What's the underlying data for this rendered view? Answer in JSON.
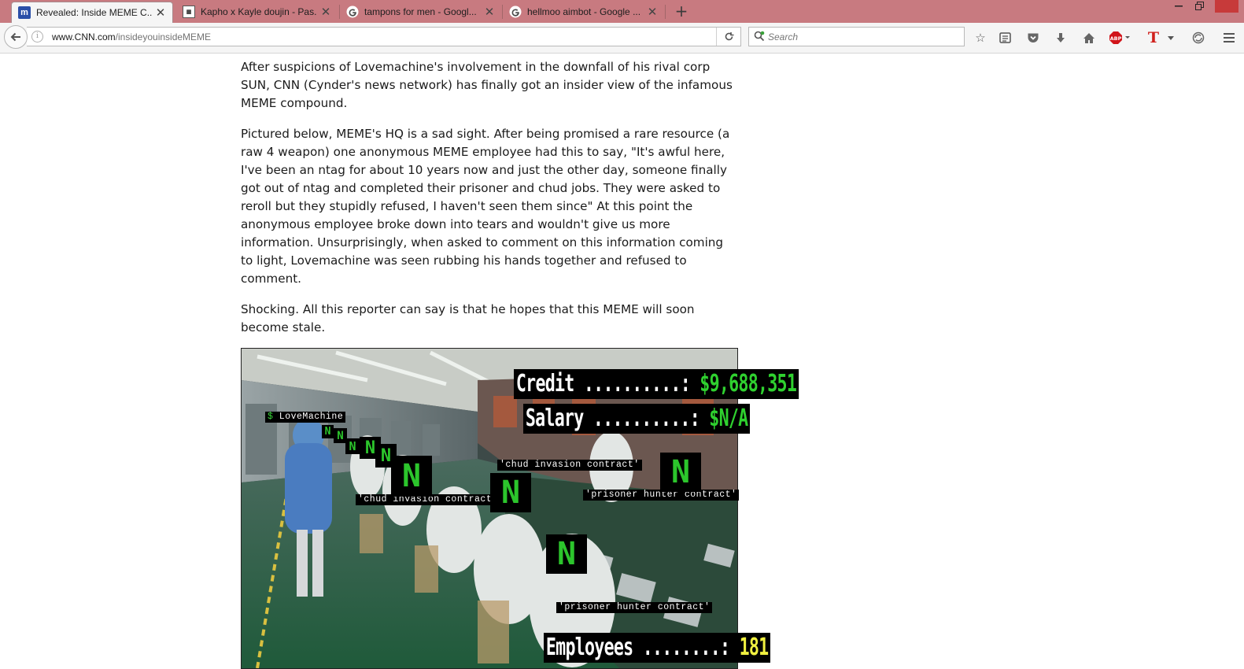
{
  "browser": {
    "tabs": [
      {
        "title": "Revealed: Inside  MEME C...",
        "favicon": "m-logo-icon",
        "active": true
      },
      {
        "title": "Kapho x Kayle doujin - Pas...",
        "favicon": "pastebin-icon",
        "active": false
      },
      {
        "title": "tampons for men - Googl...",
        "favicon": "google-icon",
        "active": false
      },
      {
        "title": "hellmoo aimbot - Google ...",
        "favicon": "google-icon",
        "active": false
      }
    ],
    "new_tab_label": "+",
    "url_host": "www.CNN.com",
    "url_path": "/insideyouinsideMEME",
    "search_placeholder": "Search",
    "colors": {
      "tabstrip": "#c87a80",
      "toolbar": "#f5f5f5",
      "abp_red": "#d1141a",
      "t_red": "#d0201c"
    },
    "toolbar_icons": [
      "star-icon",
      "reading-list-icon",
      "pocket-icon",
      "download-icon",
      "home-icon",
      "adblock-icon",
      "t-extension-icon",
      "sync-icon",
      "hamburger-menu-icon"
    ]
  },
  "article": {
    "paragraphs": [
      "After suspicions of Lovemachine's involvement in the downfall of his rival corp SUN, CNN (Cynder's news network) has finally got an insider view of the infamous MEME compound.",
      "Pictured below, MEME's HQ is a sad sight. After being promised a rare resource (a raw 4 weapon) one anonymous MEME employee had this to say, \"It's awful here, I've been an ntag for about 10 years now and just the other day, someone finally got out of ntag and completed their prisoner and chud jobs. They were asked to reroll but they stupidly refused, I haven't seen them since\" At this point the anonymous employee broke down into tears and wouldn't give us more information. Unsurprisingly, when asked to comment on this information coming to light, Lovemachine was seen rubbing his hands together and refused to comment.",
      "Shocking. All this reporter can say is that he hopes that this MEME will soon become stale."
    ]
  },
  "meme": {
    "credit_label": "Credit ..........: ",
    "credit_value": "$9,688,351",
    "salary_label": "Salary ..........: ",
    "salary_value": "$N/A",
    "employees_label": "Employees ........: ",
    "employees_value": "181",
    "lovemachine_dollar": "$",
    "lovemachine_label": " LoveMachine",
    "n_glyph": "N",
    "contract_chud_1": "'chud invasion contract'",
    "contract_chud_2": "'chud invasion contract'",
    "contract_prisoner_1": "'prisoner hunter contract'",
    "contract_prisoner_2": "'prisoner hunter contract'"
  }
}
